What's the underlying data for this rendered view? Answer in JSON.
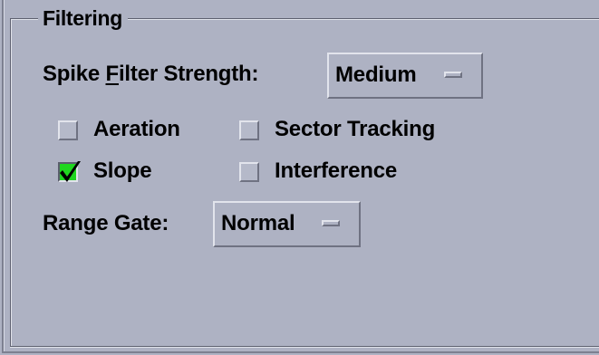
{
  "filtering": {
    "title": "Filtering",
    "spike_filter": {
      "label_before": "Spike ",
      "label_mnemonic": "F",
      "label_after": "ilter Strength:",
      "value": "Medium"
    },
    "checkboxes": {
      "aeration": {
        "label": "Aeration",
        "checked": false
      },
      "sector_tracking": {
        "label": "Sector Tracking",
        "checked": false
      },
      "slope": {
        "label": "Slope",
        "checked": true
      },
      "interference": {
        "label": "Interference",
        "checked": false
      }
    },
    "range_gate": {
      "label": "Range Gate:",
      "value": "Normal"
    }
  },
  "colors": {
    "background": "#aeb2c3",
    "checked_fill": "#1fd61f"
  },
  "icons": {
    "checkmark": "checkmark-icon",
    "option_indicator": "option-menu-indicator-icon"
  }
}
